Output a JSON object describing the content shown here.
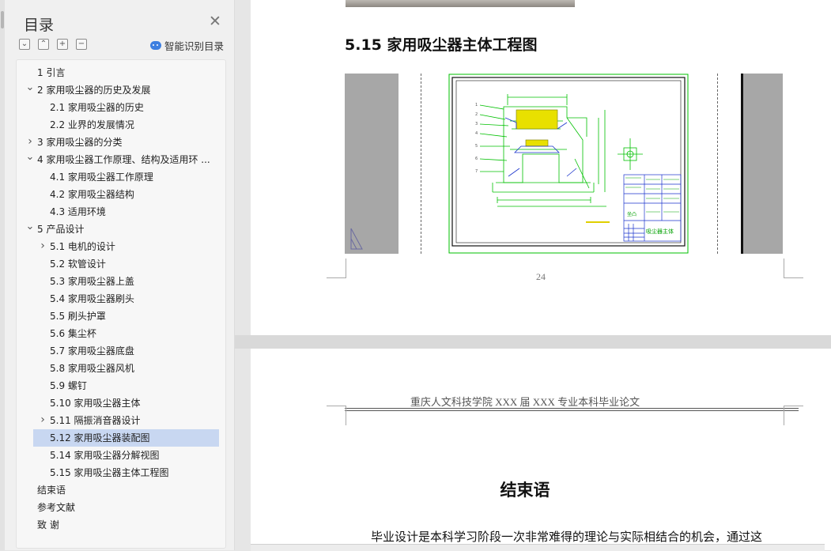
{
  "sidebar": {
    "title": "目录",
    "tools": [
      "⌄",
      "⌃",
      "+",
      "−"
    ],
    "smart_label": "智能识别目录",
    "items": [
      {
        "label": "1  引言",
        "level": 0,
        "expander": "",
        "selected": false
      },
      {
        "label": "2  家用吸尘器的历史及发展",
        "level": 0,
        "expander": "expanded",
        "selected": false
      },
      {
        "label": "2.1  家用吸尘器的历史",
        "level": 1,
        "expander": "",
        "selected": false
      },
      {
        "label": "2.2  业界的发展情况",
        "level": 1,
        "expander": "",
        "selected": false
      },
      {
        "label": "3  家用吸尘器的分类",
        "level": 0,
        "expander": "collapsed",
        "selected": false
      },
      {
        "label": "4  家用吸尘器工作原理、结构及适用环 ...",
        "level": 0,
        "expander": "expanded",
        "selected": false
      },
      {
        "label": "4.1  家用吸尘器工作原理",
        "level": 1,
        "expander": "",
        "selected": false
      },
      {
        "label": "4.2  家用吸尘器结构",
        "level": 1,
        "expander": "",
        "selected": false
      },
      {
        "label": "4.3  适用环境",
        "level": 1,
        "expander": "",
        "selected": false
      },
      {
        "label": "5  产品设计",
        "level": 0,
        "expander": "expanded",
        "selected": false
      },
      {
        "label": "5.1 电机的设计",
        "level": 1,
        "expander": "collapsed",
        "selected": false
      },
      {
        "label": "5.2 软管设计",
        "level": 1,
        "expander": "",
        "selected": false
      },
      {
        "label": "5.3 家用吸尘器上盖",
        "level": 1,
        "expander": "",
        "selected": false
      },
      {
        "label": "5.4 家用吸尘器刷头",
        "level": 1,
        "expander": "",
        "selected": false
      },
      {
        "label": "5.5 刷头护罩",
        "level": 1,
        "expander": "",
        "selected": false
      },
      {
        "label": "5.6 集尘杯",
        "level": 1,
        "expander": "",
        "selected": false
      },
      {
        "label": "5.7 家用吸尘器底盘",
        "level": 1,
        "expander": "",
        "selected": false
      },
      {
        "label": "5.8 家用吸尘器风机",
        "level": 1,
        "expander": "",
        "selected": false
      },
      {
        "label": "5.9 螺钉",
        "level": 1,
        "expander": "",
        "selected": false
      },
      {
        "label": "5.10 家用吸尘器主体",
        "level": 1,
        "expander": "",
        "selected": false
      },
      {
        "label": "5.11 隔振消音器设计",
        "level": 1,
        "expander": "collapsed",
        "selected": false
      },
      {
        "label": "5.12 家用吸尘器装配图",
        "level": 1,
        "expander": "",
        "selected": true
      },
      {
        "label": "5.14 家用吸尘器分解视图",
        "level": 1,
        "expander": "",
        "selected": false
      },
      {
        "label": "5.15 家用吸尘器主体工程图",
        "level": 1,
        "expander": "",
        "selected": false
      },
      {
        "label": "结束语",
        "level": 0,
        "expander": "",
        "selected": false
      },
      {
        "label": "参考文献",
        "level": 0,
        "expander": "",
        "selected": false
      },
      {
        "label": "致    谢",
        "level": 0,
        "expander": "",
        "selected": false
      }
    ]
  },
  "page1": {
    "section_heading": "5.15 家用吸尘器主体工程图",
    "page_number": "24",
    "drawing_title_block": "吸尘器主体",
    "drawing_label": "坐凸"
  },
  "page2": {
    "header": "重庆人文科技学院 XXX 届 XXX 专业本科毕业论文",
    "title": "结束语",
    "first_line": "毕业设计是本科学习阶段一次非常难得的理论与实际相结合的机会，通过这"
  },
  "colors": {
    "selection": "#c8d7f1",
    "cad_line": "#00c000",
    "cad_blue": "#1a33cc",
    "cad_yellow": "#e8e000"
  }
}
